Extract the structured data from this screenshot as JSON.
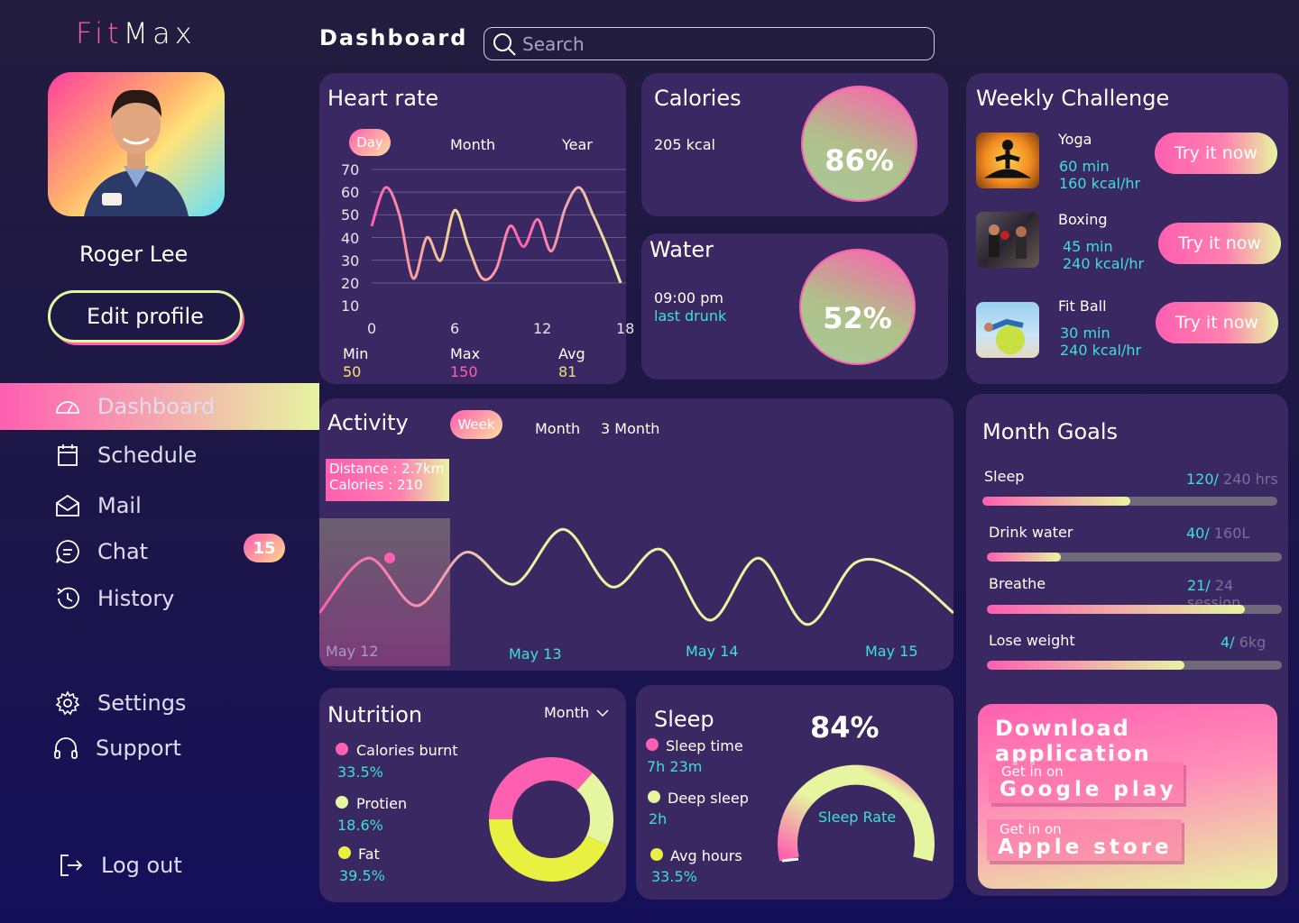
{
  "app": {
    "logo_fit": "Fit",
    "logo_max": "Max"
  },
  "user": {
    "name": "Roger Lee",
    "edit_label": "Edit profile"
  },
  "nav": {
    "items": [
      {
        "label": "Dashboard",
        "icon": "dashboard-icon"
      },
      {
        "label": "Schedule",
        "icon": "calendar-icon"
      },
      {
        "label": "Mail",
        "icon": "mail-icon"
      },
      {
        "label": "Chat",
        "icon": "chat-icon",
        "badge": "15"
      },
      {
        "label": "History",
        "icon": "history-icon"
      }
    ],
    "settings": "Settings",
    "support": "Support",
    "logout": "Log out"
  },
  "header": {
    "title": "Dashboard",
    "search_placeholder": "Search"
  },
  "heart": {
    "title": "Heart rate",
    "tabs": [
      "Day",
      "Month",
      "Year"
    ],
    "min_label": "Min",
    "min_value": "50",
    "max_label": "Max",
    "max_value": "150",
    "avg_label": "Avg",
    "avg_value": "81"
  },
  "calories": {
    "title": "Calories",
    "value": "205 kcal",
    "percent": "86%"
  },
  "water": {
    "title": "Water",
    "time": "09:00 pm",
    "note": "last drunk",
    "percent": "52%"
  },
  "challenge": {
    "title": "Weekly Challenge",
    "items": [
      {
        "name": "Yoga",
        "duration": "60 min",
        "rate": "160 kcal/hr",
        "button": "Try it now"
      },
      {
        "name": "Boxing",
        "duration": "45 min",
        "rate": "240 kcal/hr",
        "button": "Try it now"
      },
      {
        "name": "Fit Ball",
        "duration": "30 min",
        "rate": "240 kcal/hr",
        "button": "Try it now"
      }
    ]
  },
  "activity": {
    "title": "Activity",
    "tabs": [
      "Week",
      "Month",
      "3 Month"
    ],
    "tooltip_distance": "Distance : 2.7km",
    "tooltip_calories": "Calories : 210",
    "dates": [
      "May 12",
      "May 13",
      "May 14",
      "May 15"
    ]
  },
  "goals": {
    "title": "Month Goals",
    "items": [
      {
        "label": "Sleep",
        "current": "120/",
        "total": " 240 hrs",
        "progress": 0.5
      },
      {
        "label": "Drink water",
        "current": "40/",
        "total": " 160L",
        "progress": 0.25
      },
      {
        "label": "Breathe",
        "current": "21/",
        "total": " 24 session",
        "progress": 0.875
      },
      {
        "label": "Lose weight",
        "current": "4/",
        "total": " 6kg",
        "progress": 0.67
      }
    ]
  },
  "download": {
    "title": "Download application",
    "get_in_on": "Get in on",
    "google": "Google play",
    "apple": "Apple store"
  },
  "nutrition": {
    "title": "Nutrition",
    "period": "Month",
    "items": [
      {
        "label": "Calories burnt",
        "value": "33.5%",
        "color": "#ff5fb0"
      },
      {
        "label": "Protien",
        "value": "18.6%",
        "color": "#e6f5a0"
      },
      {
        "label": "Fat",
        "value": "39.5%",
        "color": "#e8f040"
      }
    ]
  },
  "sleep": {
    "title": "Sleep",
    "percent": "84%",
    "gauge_label": "Sleep Rate",
    "items": [
      {
        "label": "Sleep time",
        "value": "7h 23m",
        "color": "#ff5fb0"
      },
      {
        "label": "Deep sleep",
        "value": "2h",
        "color": "#e6f5a0"
      },
      {
        "label": "Avg hours",
        "value": "33.5%",
        "color": "#e8f040"
      }
    ]
  },
  "chart_data": [
    {
      "type": "line",
      "title": "Heart rate",
      "x": [
        0,
        1,
        2,
        3,
        4,
        5,
        6,
        7,
        8,
        9,
        10,
        11,
        12,
        13,
        14,
        15,
        16,
        17,
        18
      ],
      "xticks": [
        "0",
        "6",
        "12",
        "18"
      ],
      "yticks": [
        "70",
        "60",
        "50",
        "40",
        "30",
        "20",
        "10"
      ],
      "ylim": [
        10,
        70
      ],
      "series": [
        {
          "values": [
            45,
            62,
            50,
            22,
            40,
            30,
            52,
            36,
            22,
            26,
            45,
            36,
            48,
            34,
            53,
            62,
            50,
            36,
            20
          ]
        }
      ]
    },
    {
      "type": "line",
      "title": "Activity",
      "categories": [
        "May 12",
        "May 13",
        "May 14",
        "May 15"
      ],
      "series": [
        {
          "values": [
            20,
            58,
            25,
            62,
            40,
            78,
            38,
            64,
            15,
            58,
            12,
            55,
            48,
            20
          ]
        }
      ]
    },
    {
      "type": "pie",
      "title": "Nutrition",
      "categories": [
        "Calories burnt",
        "Protien",
        "Fat"
      ],
      "values": [
        33.5,
        18.6,
        39.5
      ]
    }
  ]
}
